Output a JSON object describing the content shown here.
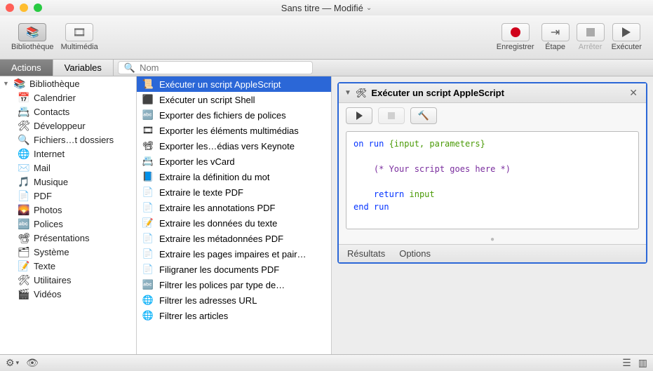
{
  "window": {
    "title": "Sans titre — Modifié"
  },
  "toolbar": {
    "library": "Bibliothèque",
    "media": "Multimédia",
    "record": "Enregistrer",
    "step": "Étape",
    "stop": "Arrêter",
    "run": "Exécuter"
  },
  "subtabs": {
    "actions": "Actions",
    "variables": "Variables",
    "search_placeholder": "Nom"
  },
  "library": {
    "root": "Bibliothèque",
    "items": [
      {
        "icon": "📅",
        "label": "Calendrier"
      },
      {
        "icon": "📇",
        "label": "Contacts"
      },
      {
        "icon": "🛠",
        "label": "Développeur"
      },
      {
        "icon": "🔍",
        "label": "Fichiers…t dossiers"
      },
      {
        "icon": "🌐",
        "label": "Internet"
      },
      {
        "icon": "✉️",
        "label": "Mail"
      },
      {
        "icon": "🎵",
        "label": "Musique"
      },
      {
        "icon": "📄",
        "label": "PDF"
      },
      {
        "icon": "🌄",
        "label": "Photos"
      },
      {
        "icon": "🔤",
        "label": "Polices"
      },
      {
        "icon": "📽",
        "label": "Présentations"
      },
      {
        "icon": "🗂",
        "label": "Système"
      },
      {
        "icon": "📝",
        "label": "Texte"
      },
      {
        "icon": "🛠",
        "label": "Utilitaires"
      },
      {
        "icon": "🎬",
        "label": "Vidéos"
      }
    ]
  },
  "actions": [
    {
      "icon": "📜",
      "label": "Exécuter un script AppleScript",
      "selected": true
    },
    {
      "icon": "⬛",
      "label": "Exécuter un script Shell"
    },
    {
      "icon": "🔤",
      "label": "Exporter des fichiers de polices"
    },
    {
      "icon": "🎞",
      "label": "Exporter les éléments multimédias"
    },
    {
      "icon": "📽",
      "label": "Exporter les…édias vers Keynote"
    },
    {
      "icon": "📇",
      "label": "Exporter les vCard"
    },
    {
      "icon": "📘",
      "label": "Extraire la définition du mot"
    },
    {
      "icon": "📄",
      "label": "Extraire le texte PDF"
    },
    {
      "icon": "📄",
      "label": "Extraire les annotations PDF"
    },
    {
      "icon": "📝",
      "label": "Extraire les données du texte"
    },
    {
      "icon": "📄",
      "label": "Extraire les métadonnées PDF"
    },
    {
      "icon": "📄",
      "label": "Extraire les pages impaires et pair…"
    },
    {
      "icon": "📄",
      "label": "Filigraner les documents PDF"
    },
    {
      "icon": "🔤",
      "label": "Filtrer les polices par type de…"
    },
    {
      "icon": "🌐",
      "label": "Filtrer les adresses URL"
    },
    {
      "icon": "🌐",
      "label": "Filtrer les articles"
    }
  ],
  "workflow_step": {
    "title": "Exécuter un script AppleScript",
    "code_line1_kw": "on run",
    "code_line1_args": " {input, parameters}",
    "code_comment": "(* Your script goes here *)",
    "code_return_kw": "return",
    "code_return_val": " input",
    "code_end": "end run",
    "results": "Résultats",
    "options": "Options"
  }
}
